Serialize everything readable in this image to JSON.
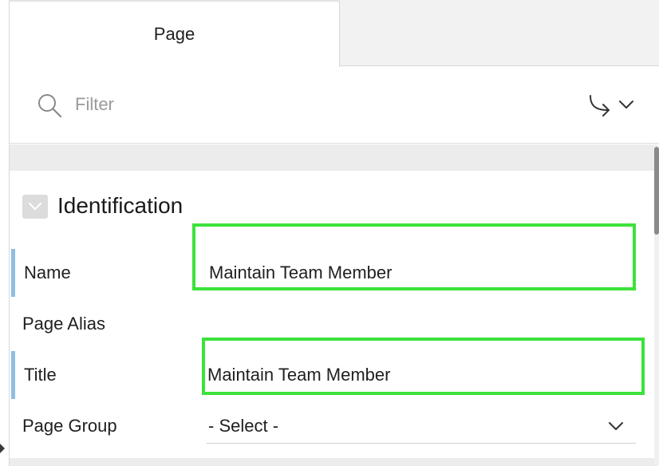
{
  "tabs": {
    "active_label": "Page"
  },
  "filter": {
    "placeholder": "Filter",
    "value": "",
    "search_icon": "search-icon",
    "goto_icon": "goto-arrow-icon",
    "dropdown_icon": "chevron-down-icon"
  },
  "section": {
    "title": "Identification",
    "collapse_icon": "chevron-down-icon"
  },
  "properties": {
    "name": {
      "label": "Name",
      "value": "Maintain Team Member"
    },
    "page_alias": {
      "label": "Page Alias",
      "value": ""
    },
    "title": {
      "label": "Title",
      "value": "Maintain Team Member"
    },
    "page_group": {
      "label": "Page Group",
      "value": "- Select -"
    }
  },
  "colors": {
    "highlight": "#3be23b",
    "required_marker": "#8fbde3",
    "band": "#ececec"
  }
}
